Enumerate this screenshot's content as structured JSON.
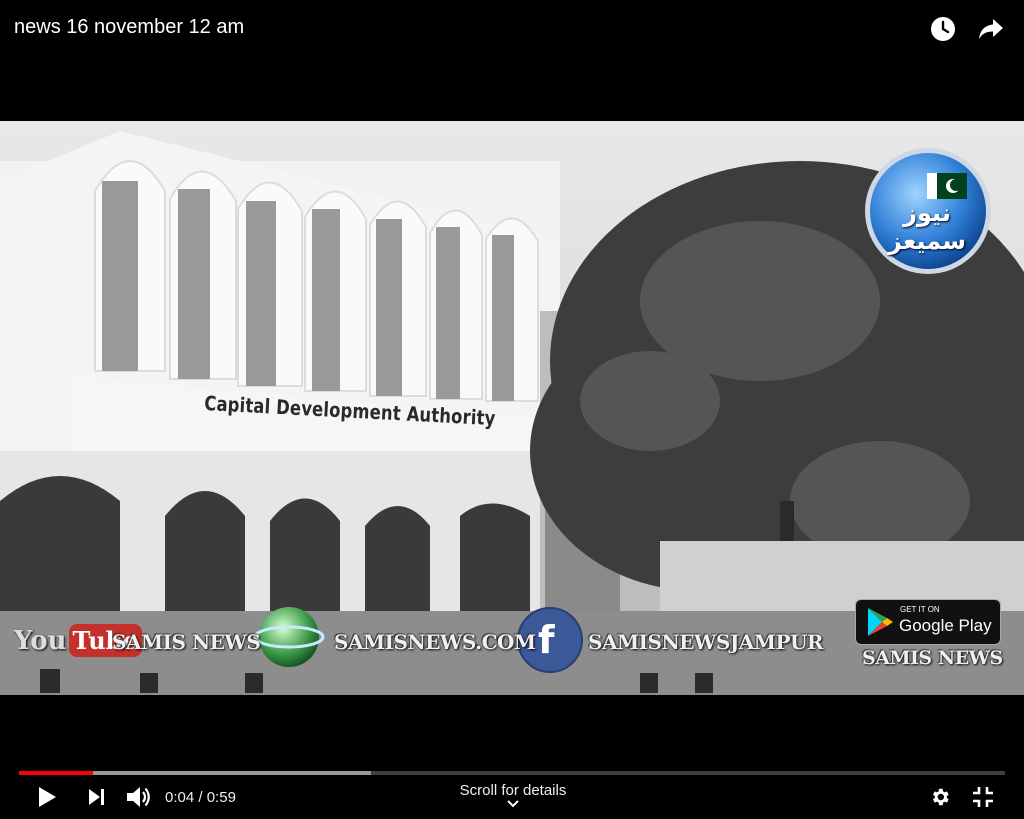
{
  "player": {
    "title": "news 16 november 12 am",
    "time_current": "0:04",
    "time_separator": " / ",
    "time_total": "0:59",
    "scroll_hint": "Scroll for details",
    "progress_played": 0.075,
    "progress_buffered": 0.357,
    "accent_color": "#ff0000"
  },
  "icons": {
    "watch_later": "clock-icon",
    "share": "share-icon",
    "play": "play-icon",
    "next": "next-icon",
    "volume": "volume-icon",
    "settings": "gear-icon",
    "exit_fullscreen": "exit-fullscreen-icon",
    "chevron": "chevron-down-icon"
  },
  "video": {
    "building_sign": "Capital Development Authority",
    "channel_logo_text": "نیوز سمیعز",
    "banner": {
      "youtube_you": "You",
      "youtube_tube": "Tube",
      "youtube_channel": "SAMIS NEWS",
      "website": "SAMISNEWS.COM",
      "facebook_letter": "f",
      "facebook_page": "SAMISNEWSJAMPUR",
      "gplay_small": "GET IT ON",
      "gplay_big": "Google Play",
      "gplay_caption": "SAMIS NEWS"
    }
  }
}
